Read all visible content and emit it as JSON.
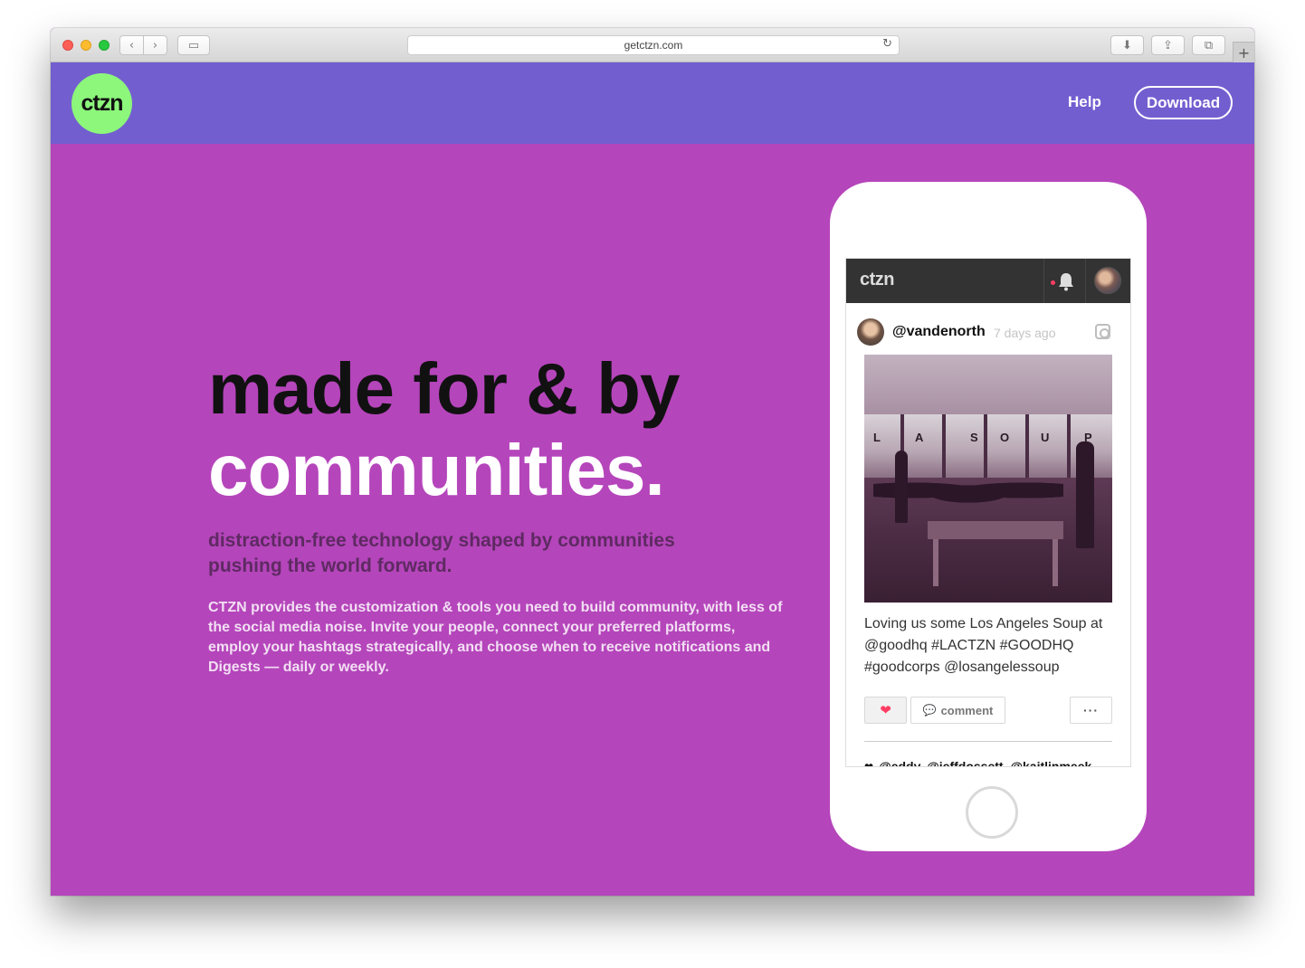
{
  "browser": {
    "url": "getctzn.com",
    "nav_back_glyph": "‹",
    "nav_forward_glyph": "›",
    "sidebar_glyph": "▭",
    "reload_glyph": "↻",
    "download_glyph": "⬇",
    "share_glyph": "⇪",
    "tabs_glyph": "⧉",
    "new_tab_glyph": "+"
  },
  "header": {
    "logo_text": "ctzn",
    "help_label": "Help",
    "download_label": "Download",
    "background_color": "#735ed0",
    "logo_color": "#8cf77b"
  },
  "hero": {
    "headline_line1": "made for & by",
    "headline_line2": "communities.",
    "subheadline": "distraction-free technology shaped by communities pushing the world forward.",
    "description": "CTZN provides the customization & tools you need to build community, with less of the social media noise. Invite your people, connect your preferred platforms, employ your hashtags strategically, and choose when to receive notifications and Digests — daily or weekly.",
    "background_color": "#b545bb"
  },
  "phone_app": {
    "app_logo": "ctzn",
    "post": {
      "username": "@vandenorth",
      "timestamp": "7 days ago",
      "photo_letters": [
        "L",
        "A",
        "S",
        "O",
        "U",
        "P"
      ],
      "caption": "Loving us some Los Angeles Soup at @goodhq #LACTZN #GOODHQ #goodcorps @losangelessoup",
      "like_glyph": "❤",
      "comment_label": "comment",
      "comment_glyph": "💬",
      "more_label": "···",
      "likers_heart": "❤",
      "likers": "@eddy, @jeffdossett, @kaitlinmeek"
    },
    "icons": [
      "bell-icon",
      "instagram-icon",
      "heart-icon",
      "comment-icon"
    ],
    "accent_color": "#ff3d63"
  }
}
